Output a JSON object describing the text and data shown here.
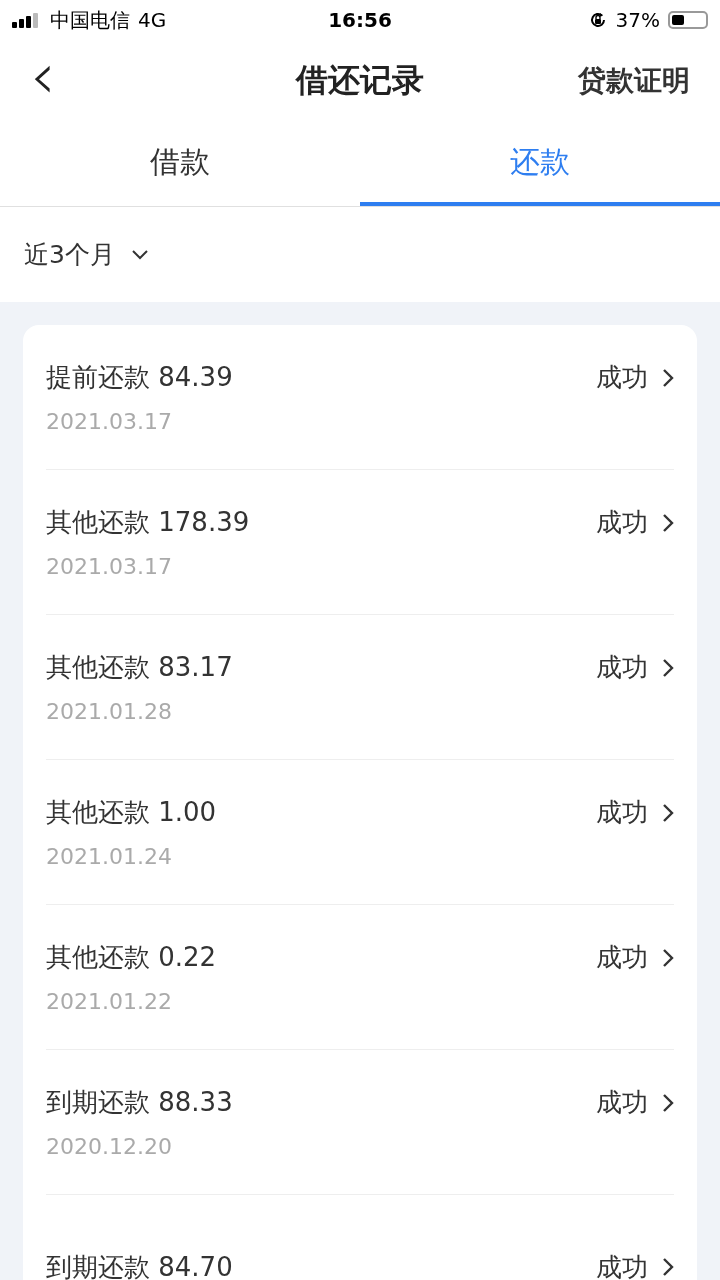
{
  "status_bar": {
    "carrier": "中国电信",
    "network": "4G",
    "time": "16:56",
    "battery": {
      "text": "37%",
      "level": 0.37
    }
  },
  "nav": {
    "back": "‹",
    "title": "借还记录",
    "action": "贷款证明"
  },
  "tabs": [
    {
      "label": "借款",
      "selected": false
    },
    {
      "label": "还款",
      "selected": true
    }
  ],
  "filter": {
    "label": "近3个月"
  },
  "records": [
    {
      "title": "提前还款 84.39",
      "date": "2021.03.17",
      "status": "成功"
    },
    {
      "title": "其他还款 178.39",
      "date": "2021.03.17",
      "status": "成功"
    },
    {
      "title": "其他还款 83.17",
      "date": "2021.01.28",
      "status": "成功"
    },
    {
      "title": "其他还款 1.00",
      "date": "2021.01.24",
      "status": "成功"
    },
    {
      "title": "其他还款 0.22",
      "date": "2021.01.22",
      "status": "成功"
    },
    {
      "title": "到期还款 88.33",
      "date": "2020.12.20",
      "status": "成功"
    },
    {
      "title": "到期还款 84.70",
      "status": "成功"
    }
  ]
}
